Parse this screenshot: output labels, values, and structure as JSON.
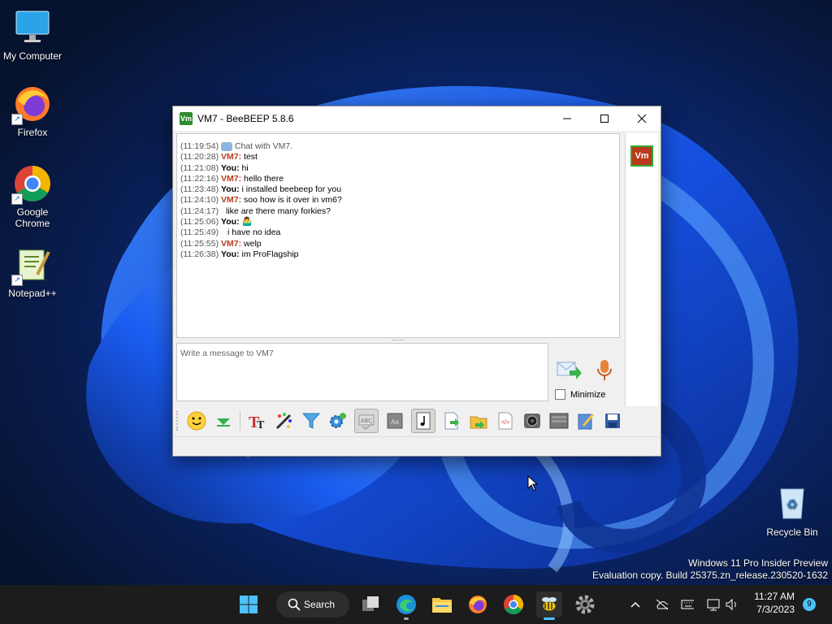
{
  "desktop": {
    "icons": [
      {
        "label": "My Computer"
      },
      {
        "label": "Firefox"
      },
      {
        "label": "Google Chrome"
      },
      {
        "label": "Notepad++"
      },
      {
        "label": "Recycle Bin"
      }
    ],
    "watermark": {
      "line1": "Windows 11 Pro Insider Preview",
      "line2": "Evaluation copy. Build 25375.zn_release.230520-1632"
    }
  },
  "window": {
    "app_icon_text": "Vm",
    "title": "VM7 - BeeBEEP 5.8.6",
    "chat": [
      {
        "time": "(11:19:54)",
        "sender": "",
        "text": "Chat with VM7.",
        "kind": "system"
      },
      {
        "time": "(11:20:28)",
        "sender": "VM7:",
        "text": "test",
        "kind": "vm"
      },
      {
        "time": "(11:21:08)",
        "sender": "You:",
        "text": "hi",
        "kind": "you"
      },
      {
        "time": "(11:22:16)",
        "sender": "VM7:",
        "text": "hello there",
        "kind": "vm"
      },
      {
        "time": "(11:23:48)",
        "sender": "You:",
        "text": "i installed beebeep for you",
        "kind": "you"
      },
      {
        "time": "(11:24:10)",
        "sender": "VM7:",
        "text": "soo how is it over in vm6?",
        "kind": "vm"
      },
      {
        "time": "(11:24:17)",
        "sender": "",
        "text": "like are there many forkies?",
        "kind": "cont"
      },
      {
        "time": "(11:25:06)",
        "sender": "You:",
        "text": "🤷‍♂️",
        "kind": "you"
      },
      {
        "time": "(11:25:49)",
        "sender": "",
        "text": "i have no idea",
        "kind": "cont"
      },
      {
        "time": "(11:25:55)",
        "sender": "VM7:",
        "text": "welp",
        "kind": "vm"
      },
      {
        "time": "(11:26:38)",
        "sender": "You:",
        "text": "im ProFlagship",
        "kind": "you"
      }
    ],
    "input_placeholder": "Write a message to VM7",
    "minimize_label": "Minimize",
    "side_badge": "Vm",
    "toolbar": [
      "emoticons-icon",
      "down-arrow-icon",
      "font-icon",
      "color-icon",
      "filter-icon",
      "settings-icon",
      "spellcheck-icon",
      "text-box-icon",
      "music-note-icon",
      "send-file-icon",
      "folder-share-icon",
      "html-icon",
      "screenshot-icon",
      "shelf-icon",
      "edit-icon",
      "save-icon"
    ]
  },
  "taskbar": {
    "search_label": "Search",
    "time": "11:27 AM",
    "date": "7/3/2023",
    "notifications": "9"
  },
  "colors": {
    "vm_sender": "#b93a1c",
    "taskbar": "#1c1c1c",
    "accent": "#4cc2ff"
  }
}
